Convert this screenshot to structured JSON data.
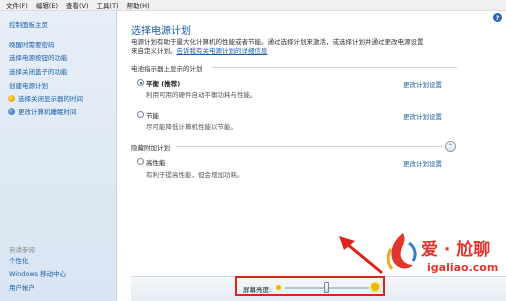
{
  "menu": [
    "文件(F)",
    "编辑(E)",
    "查看(V)",
    "工具(T)",
    "帮助(H)"
  ],
  "sidebar": {
    "home": "控制面板主页",
    "links": [
      "唤醒时需要密码",
      "选择电源按钮的功能",
      "选择关闭盖子的功能",
      "创建电源计划",
      "选择关闭显示器的时间",
      "更改计算机睡眠时间"
    ],
    "see_also_title": "另请参阅",
    "see_also": [
      "个性化",
      "Windows 移动中心",
      "用户帐户"
    ]
  },
  "main": {
    "title": "选择电源计划",
    "intro_line1": "电源计划有助于最大化计算机的性能或者节能。通过选择计划来激活，或选择计划并通过更改电源设置",
    "intro_line2_prefix": "来自定义计划。",
    "intro_link": "告诉我有关电源计划的详细信息",
    "section_shown": "电池指示器上显示的计划",
    "plans": [
      {
        "name": "平衡 (推荐)",
        "desc": "利用可用的硬件自动平衡功耗与性能。",
        "link": "更改计划设置",
        "selected": true
      },
      {
        "name": "节能",
        "desc": "尽可能降低计算机性能以节能。",
        "link": "更改计划设置",
        "selected": false
      }
    ],
    "section_hidden": "隐藏附加计划",
    "hidden_plans": [
      {
        "name": "高性能",
        "desc": "有利于提高性能，但会增加功耗。",
        "link": "更改计划设置",
        "selected": false
      }
    ],
    "collapse_glyph": "⌃"
  },
  "brightness": {
    "label": "屏幕亮度:",
    "level_fraction": 0.5
  },
  "help_glyph": "?",
  "watermark": {
    "title": "爱 · 尬聊",
    "url": "igaliao.com"
  },
  "colors": {
    "link": "#1a5fa8",
    "title": "#1e5aa0",
    "highlight": "#e0241b",
    "watermark": "#e1352d"
  },
  "icons": [
    "help-icon",
    "shield-icon",
    "moon-icon",
    "collapse-icon",
    "sun-small-icon",
    "sun-big-icon",
    "arrow-annotation",
    "watermark-logo"
  ]
}
